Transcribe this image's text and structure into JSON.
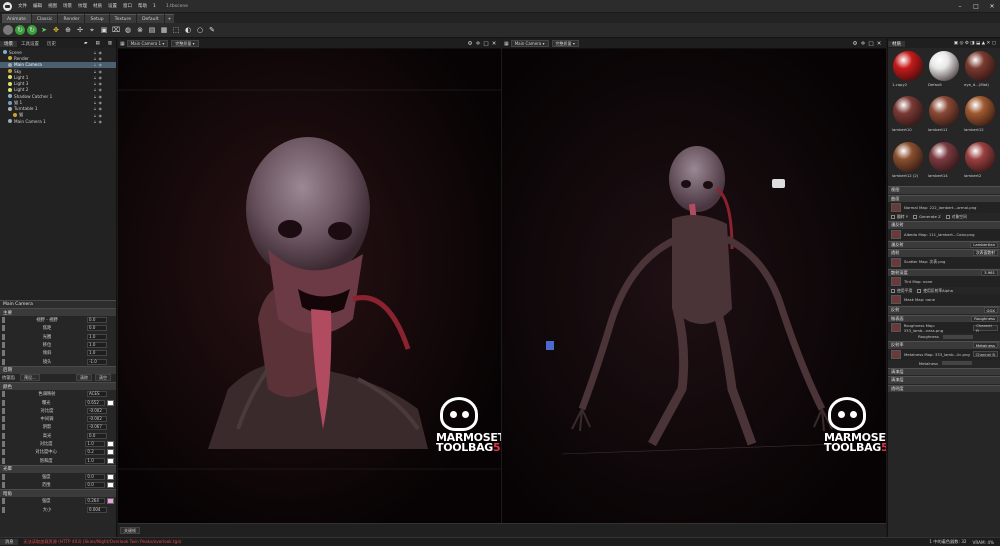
{
  "app": {
    "title": "1.tbscene",
    "menu": [
      "文件",
      "编辑",
      "视图",
      "场景",
      "纹理",
      "材质",
      "设置",
      "窗口",
      "帮助",
      "1"
    ]
  },
  "tabs": [
    "Animate",
    "Classic",
    "Render",
    "Setup",
    "Texture",
    "Default"
  ],
  "left_panel": {
    "tabs": [
      "场景",
      "工具设置",
      "历史"
    ],
    "tree": [
      {
        "label": "Scene",
        "icon_color": "#7fb0d0",
        "indent": 0
      },
      {
        "label": "Render",
        "icon_color": "#d0b040",
        "indent": 1
      },
      {
        "label": "Main Camera",
        "icon_color": "#9aa8b8",
        "indent": 1,
        "selected": true
      },
      {
        "label": "Sky",
        "icon_color": "#c8a040",
        "indent": 1
      },
      {
        "label": "Light 1",
        "icon_color": "#e0e070",
        "indent": 1
      },
      {
        "label": "Light 3",
        "icon_color": "#e0e070",
        "indent": 1
      },
      {
        "label": "Light 2",
        "icon_color": "#e0e070",
        "indent": 1
      },
      {
        "label": "Shadow Catcher 1",
        "icon_color": "#8ab0c0",
        "indent": 1
      },
      {
        "label": "猫 1",
        "icon_color": "#70a0d0",
        "indent": 1
      },
      {
        "label": "Turntable 1",
        "icon_color": "#b0b0b0",
        "indent": 1
      },
      {
        "label": "猫",
        "icon_color": "#d0a030",
        "indent": 2
      },
      {
        "label": "Main Camera 1",
        "icon_color": "#9aa8b8",
        "indent": 1
      }
    ],
    "props_header": "Main Camera",
    "sections": {
      "camera": "主要",
      "effects": "后期",
      "color": "颜色"
    },
    "camera_props": [
      {
        "label": "视野 - 视野",
        "value": "0.0"
      },
      {
        "label": "焦距",
        "value": "0.0"
      },
      {
        "label": "光圈",
        "value": "1.0"
      },
      {
        "label": "移位",
        "value": "1.0"
      },
      {
        "label": "倾斜",
        "value": "1.0"
      },
      {
        "label": "镜头",
        "value": "-1.0"
      }
    ],
    "effects_row": {
      "label1": "抗锯齿",
      "label2": "预设...",
      "label3": "清除",
      "label4": "清空"
    },
    "color_props": [
      {
        "label": "色调映射",
        "value": "ACES"
      },
      {
        "label": "曝光",
        "value": "0.652"
      },
      {
        "label": "对比度",
        "value": "-0.002"
      },
      {
        "label": "中间调",
        "value": "-0.002"
      },
      {
        "label": "阴影",
        "value": "-0.067"
      },
      {
        "label": "高光",
        "value": "0.0"
      },
      {
        "label": "对比度",
        "value": "1.0"
      },
      {
        "label": "对比度中心",
        "value": "0.2"
      },
      {
        "label": "饱和度",
        "value": "1.0"
      }
    ],
    "bloom": {
      "header": "光晕",
      "props": [
        {
          "label": "强度",
          "value": "0.0"
        },
        {
          "label": "范围",
          "value": "0.0"
        }
      ]
    },
    "vignette": {
      "header": "暗角",
      "props": [
        {
          "label": "强度",
          "value": "0.264"
        },
        {
          "label": "大小",
          "value": "0.004"
        }
      ]
    }
  },
  "viewport_left": {
    "camera": "Main Camera 1",
    "mode": "完整质量",
    "footer": ""
  },
  "viewport_right": {
    "camera": "Main Camera",
    "mode": "完整质量",
    "footer": "关键帧"
  },
  "watermark": {
    "line1": "MARMOSET",
    "line2": "TOOLBAG",
    "version": "5"
  },
  "right_panel": {
    "tabs": [
      "材质"
    ],
    "materials": [
      {
        "name": "1.copy2",
        "color": "#c61a1a"
      },
      {
        "name": "Default",
        "color": "#e8e8e8"
      },
      {
        "name": "eye_d...(Mat)",
        "color": "#7a3a30"
      },
      {
        "name": "lambert10",
        "color": "#7a3a35"
      },
      {
        "name": "lambert11",
        "color": "#8a4a35"
      },
      {
        "name": "lambert12",
        "color": "#a05a30"
      },
      {
        "name": "lambert12 (2)",
        "color": "#8a5030"
      },
      {
        "name": "lambert14",
        "color": "#7a3a40"
      },
      {
        "name": "lambert2",
        "color": "#9a4040"
      }
    ],
    "sections": [
      {
        "label": "视图",
        "dropdown": ""
      },
      {
        "label": "曲面",
        "dropdown": ""
      },
      {
        "label": "Normal Map: 222_lambert...ormal.png",
        "dropdown": ""
      },
      {
        "label": "漫反射",
        "dropdown": ""
      },
      {
        "label": "Albedo Map: 111_lambert...Color.png",
        "dropdown": ""
      },
      {
        "label": "漫反射",
        "dropdown": "Lambertian"
      },
      {
        "label": "透射",
        "dropdown": "次表面散射"
      },
      {
        "label": "Scatter Map: 次表.png",
        "dropdown": ""
      },
      {
        "label": "散射深度",
        "dropdown": "3.961"
      },
      {
        "label": "Tint Map: none",
        "dropdown": ""
      },
      {
        "label": "Mask Map: none",
        "dropdown": ""
      },
      {
        "label": "反射",
        "dropdown": "GGX"
      },
      {
        "label": "微表面",
        "dropdown": "Roughness"
      },
      {
        "label": "Roughness Map: 333_lamb...ness.png",
        "dropdown": "Channel R"
      },
      {
        "label": "反射率",
        "dropdown": "Metalness"
      },
      {
        "label": "Metalness Map: 333_lamb...lic.png",
        "dropdown": "Channel B"
      },
      {
        "label": "清漆层",
        "dropdown": ""
      },
      {
        "label": "清漆层",
        "dropdown": ""
      },
      {
        "label": "透明度",
        "dropdown": ""
      }
    ],
    "misc_rows": [
      "翻转 Y",
      "Generate Z",
      "对象空间",
      "使用平滑",
      "使用反射率Alpha",
      "Roughness",
      "Metalness"
    ]
  },
  "status": {
    "left_label": "消息",
    "message": "无法读取加载资源 (HTTP 403) (Skies/Night/Overlook Twin Peaks/overlook.tga)",
    "right": "1 中的着色器数: 32",
    "vram": "VRAM: 4%"
  },
  "colors": {
    "accent_selected": "#4a6070",
    "brand_red": "#e0354a",
    "ui_bg": "#262626"
  }
}
